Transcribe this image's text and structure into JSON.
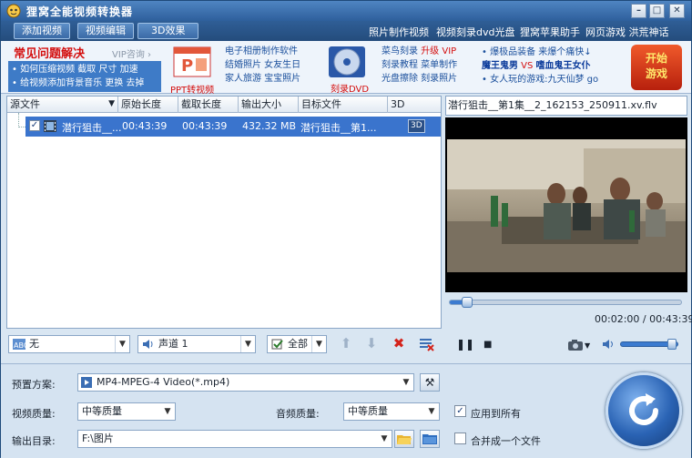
{
  "window": {
    "title": "狸窝全能视频转换器",
    "min_glyph": "–",
    "max_glyph": "□",
    "close_glyph": "✕"
  },
  "toolbar": {
    "add_video": "添加视频",
    "edit_video": "视频编辑",
    "effect_3d": "3D效果",
    "links": [
      "照片制作视频",
      "视频刻录dvd光盘",
      "狸窝苹果助手",
      "网页游戏 洪荒神话"
    ]
  },
  "banner": {
    "faq_title": "常见问题解决",
    "faq_vip": "VIP咨询 ›",
    "faq_line1": "• 如何压缩视频  截取  尺寸  加速",
    "faq_line2": "• 给视频添加背景音乐  更换  去掉",
    "ppt_label": "PPT转视频",
    "col1": [
      "电子相册制作软件",
      "结婚照片  女友生日",
      "家人旅游  宝宝照片"
    ],
    "dvd_label": "刻录DVD",
    "col2_line1_a": "菜鸟刻录",
    "col2_line1_b": "升级 VIP",
    "col2_line2": "刻录教程  菜单制作",
    "col2_line3": "光盘擦除  刻录照片",
    "games_line1": "• 爆极品装备  来爆个痛快↓",
    "games_line2_a": "魔王鬼男",
    "games_line2_b": " VS ",
    "games_line2_c": "嗜血鬼王女仆",
    "games_line3": "• 女人玩的游戏:九天仙梦  go",
    "start_game": "开始\n游戏"
  },
  "file_list": {
    "columns": [
      "源文件",
      "原始长度",
      "截取长度",
      "输出大小",
      "目标文件",
      "3D"
    ],
    "rows": [
      {
        "checked": true,
        "source": "潜行狙击__...",
        "original_length": "00:43:39",
        "cut_length": "00:43:39",
        "output_size": "432.32 MB",
        "target": "潜行狙击__第1...",
        "badge_3d": "3D"
      }
    ]
  },
  "list_controls": {
    "subtitle": "无",
    "audio_track": "声道 1",
    "select_mode": "全部"
  },
  "preview": {
    "filename": "潜行狙击__第1集__2_162153_250911.xv.flv",
    "progress_fraction": 0.05,
    "current_time": "00:02:00",
    "separator": " / ",
    "total_time": "00:43:39",
    "volume_fraction": 0.9
  },
  "settings": {
    "preset_label": "预置方案:",
    "preset_value": "MP4-MPEG-4 Video(*.mp4)",
    "video_quality_label": "视频质量:",
    "video_quality_value": "中等质量",
    "audio_quality_label": "音频质量:",
    "audio_quality_value": "中等质量",
    "apply_all_label": "应用到所有",
    "apply_all_checked": true,
    "output_dir_label": "输出目录:",
    "output_dir_value": "F:\\图片",
    "merge_label": "合并成一个文件",
    "merge_checked": false
  },
  "colors": {
    "accent": "#3a74cd",
    "title_bar": "#2e5f9c",
    "faq_red": "#d40f0f"
  }
}
